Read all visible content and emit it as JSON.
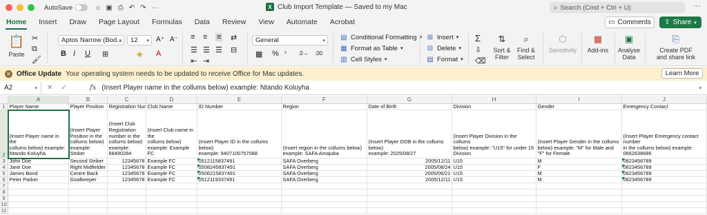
{
  "titlebar": {
    "autosave_label": "AutoSave",
    "doc_title": "Club Import Template — Saved to my Mac",
    "search_placeholder": "Search (Cmd + Ctrl + U)"
  },
  "tabs": [
    "Home",
    "Insert",
    "Draw",
    "Page Layout",
    "Formulas",
    "Data",
    "Review",
    "View",
    "Automate",
    "Acrobat"
  ],
  "comments_label": "Comments",
  "share_label": "Share",
  "ribbon": {
    "paste": "Paste",
    "font_name": "Aptos Narrow (Bod...",
    "font_size": "12",
    "number_format": "General",
    "conditional_formatting": "Conditional Formatting",
    "format_as_table": "Format as Table",
    "cell_styles": "Cell Styles",
    "insert": "Insert",
    "delete": "Delete",
    "format": "Format",
    "sort_filter": [
      "Sort &",
      "Filter"
    ],
    "find_select": [
      "Find &",
      "Select"
    ],
    "sensitivity": "Sensitivity",
    "addins": "Add-ins",
    "analyse_data": [
      "Analyse",
      "Data"
    ],
    "create_pdf": [
      "Create PDF",
      "and share link"
    ]
  },
  "notice": {
    "title": "Office Update",
    "message": "Your operating system needs to be updated to receive Office for Mac updates.",
    "button": "Learn More"
  },
  "formula_bar": {
    "name_box": "A2",
    "fx": "fx",
    "value": "(Insert Player name in the collums below) example: Ntando Koluyha"
  },
  "sheet": {
    "columns": [
      "A",
      "B",
      "C",
      "D",
      "E",
      "F",
      "G",
      "H",
      "I",
      "J"
    ],
    "row_numbers": [
      "1",
      "2",
      "3",
      "4",
      "5",
      "6",
      "7",
      "8",
      "9",
      "10",
      "11"
    ],
    "headers": [
      "Player Name",
      "Player Position",
      "Registration Numbe",
      "Club Name",
      "ID Number",
      "Region",
      "Date of Birth",
      "Division",
      "Gender",
      "Emergency Contact"
    ],
    "instructions": [
      [
        "(Insert Player name in the",
        "collums below) example:",
        "Ntando Koluyha"
      ],
      [
        "(Insert Player",
        "Position in the",
        "collums below)",
        "example: Striker"
      ],
      [
        "(Insert Club",
        "Registration",
        "number in the",
        "collums below)",
        "example:",
        "68490284"
      ],
      [
        "(Insert Club name in the",
        "collums below)",
        "example: Example FC"
      ],
      [
        "(Insert Player ID in the collums below)",
        "example: 9407100757088"
      ],
      [
        "(Insert region in the collums below)",
        "example: SAFA Amajuba"
      ],
      [
        "(Insert Player DOB in the collums below)",
        "example: 2025/08/27"
      ],
      [
        "(Insert Player Division in the collums",
        "below) example: \"U15\" for under 15",
        "Division"
      ],
      [
        "(Insert Player Gender in the collums",
        "below) example: \"M\" for Male and \"F\" for Female"
      ],
      [
        "(Insert Player Emergency contact number",
        "in the collums below) example:",
        "0662638686"
      ]
    ],
    "rows": [
      [
        "John Doe",
        "Second Striker",
        "12345678",
        "Example FC",
        "0512115837491",
        "SAFA Overberg",
        "2005/12/11",
        "U15",
        "M",
        "0823456789"
      ],
      [
        "Jane Doe",
        "Right Midfielder",
        "12345678",
        "Example FC",
        "0508245837491",
        "SAFA Overberg",
        "2005/08/24",
        "U15",
        "F",
        "0823456789"
      ],
      [
        "James Bond",
        "Centre Back",
        "12345678",
        "Example FC",
        "0506215837491",
        "SAFA Overberg",
        "2005/06/21",
        "U15",
        "M",
        "0823456789"
      ],
      [
        "Peter Parker",
        "Goalkeeper",
        "12345678",
        "Example FC",
        "0512119337491",
        "SAFA Overberg",
        "2005/12/11",
        "U15",
        "M",
        "0823456789"
      ]
    ]
  },
  "colors": {
    "accent": "#1d6f42",
    "notice_bg": "#fcf0cf"
  }
}
